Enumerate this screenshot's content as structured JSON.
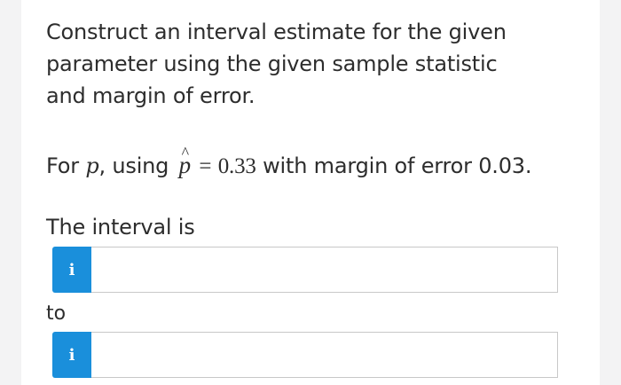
{
  "question": {
    "prompt": "Construct an interval estimate for the given parameter using the given sample statistic and margin of error.",
    "given_prefix": "For",
    "parameter_symbol": "p",
    "using_text": ", using",
    "statistic_symbol": "p",
    "statistic_hat": "^",
    "equals": "=",
    "statistic_value": "0.33",
    "margin_text": "with margin of error 0.03",
    "period": "."
  },
  "answer": {
    "interval_label": "The interval is",
    "connector_label": "to",
    "lower_value": "",
    "upper_value": "",
    "info_glyph": "i",
    "info_icon": "info-icon"
  },
  "colors": {
    "info_button": "#1a8fdb",
    "text": "#2d2d2d",
    "input_border": "#c8c8c8"
  }
}
